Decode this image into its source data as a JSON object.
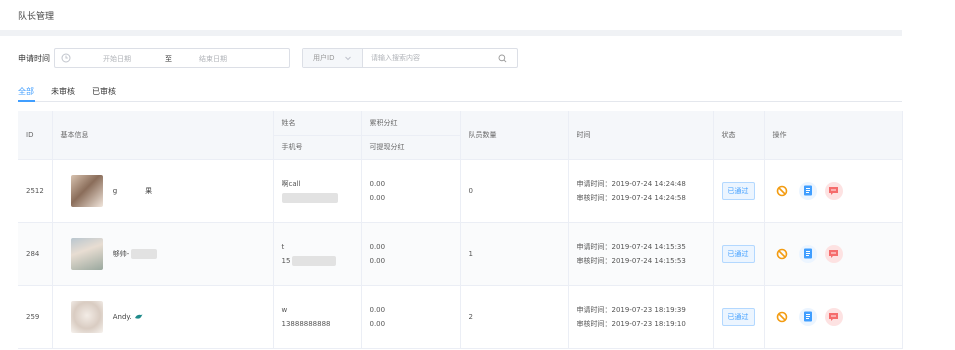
{
  "page": {
    "title": "队长管理"
  },
  "filter": {
    "label": "申请时间",
    "start_placeholder": "开始日期",
    "separator": "至",
    "end_placeholder": "结束日期",
    "search_type": "用户ID",
    "search_placeholder": "请输入搜索内容"
  },
  "tabs": [
    {
      "label": "全部"
    },
    {
      "label": "未审核"
    },
    {
      "label": "已审核"
    }
  ],
  "table": {
    "headers": {
      "id": "ID",
      "info": "基本信息",
      "name": "姓名",
      "phone": "手机号",
      "earned": "累积分红",
      "withdrawable": "可提现分红",
      "members": "队员数量",
      "time": "时间",
      "status": "状态",
      "actions": "操作"
    },
    "rows": [
      {
        "id": "2512",
        "nickname": "g　　　　果",
        "name": "啊call",
        "phone": "",
        "earned": "0.00",
        "withdrawable": "0.00",
        "members": "0",
        "apply_time": "申请时间：2019-07-24 14:24:48",
        "review_time": "审核时间：2019-07-24 14:24:58",
        "status": "已通过"
      },
      {
        "id": "284",
        "nickname": "够帅-",
        "name": "t",
        "phone": "15",
        "earned": "0.00",
        "withdrawable": "0.00",
        "members": "1",
        "apply_time": "申请时间：2019-07-24 14:15:35",
        "review_time": "审核时间：2019-07-24 14:15:53",
        "status": "已通过"
      },
      {
        "id": "259",
        "nickname": "Andy.",
        "name": "w",
        "phone": "13888888888",
        "earned": "0.00",
        "withdrawable": "0.00",
        "members": "2",
        "apply_time": "申请时间：2019-07-23 18:19:39",
        "review_time": "审核时间：2019-07-23 18:19:10",
        "status": "已通过"
      }
    ]
  },
  "colors": {
    "accent": "#409eff",
    "danger": "#f56c6c",
    "warning": "#f39c12"
  }
}
